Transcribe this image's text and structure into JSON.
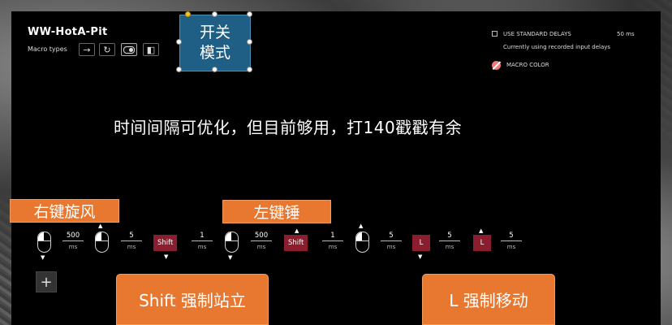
{
  "macro": {
    "name": "WW-HotA-Pit",
    "types_label": "Macro types"
  },
  "macro_type_buttons": [
    {
      "icon": "arrow-right-icon",
      "glyph": "→",
      "active": false
    },
    {
      "icon": "repeat-icon",
      "glyph": "↻",
      "active": false
    },
    {
      "icon": "toggle-icon",
      "glyph": "",
      "active": true
    },
    {
      "icon": "hold-icon",
      "glyph": "◧",
      "active": false
    }
  ],
  "sticky_note": {
    "line1": "开关",
    "line2": "模式"
  },
  "options": {
    "use_standard_delays_label": "USE STANDARD DELAYS",
    "delay_value": "50 ms",
    "recorded_info": "Currently using recorded input delays",
    "macro_color_label": "MACRO COLOR"
  },
  "caption": "时间间隔可优化，但目前够用，打140戳戳有余",
  "annotations": {
    "right_key_whirlwind": "右键旋风",
    "left_key_hammer": "左键锤",
    "shift_force_stand": "Shift 强制站立",
    "l_force_move": "L 强制移动"
  },
  "sequence": [
    {
      "type": "mouse",
      "direction": "down"
    },
    {
      "type": "delay",
      "value": "500",
      "unit": "ms"
    },
    {
      "type": "mouse",
      "direction": "up"
    },
    {
      "type": "delay",
      "value": "5",
      "unit": "ms"
    },
    {
      "type": "key",
      "label": "Shift",
      "direction": "down"
    },
    {
      "type": "delay",
      "value": "1",
      "unit": "ms"
    },
    {
      "type": "mouse",
      "direction": "down"
    },
    {
      "type": "delay",
      "value": "500",
      "unit": "ms"
    },
    {
      "type": "key",
      "label": "Shift",
      "direction": "up"
    },
    {
      "type": "delay",
      "value": "1",
      "unit": "ms"
    },
    {
      "type": "mouse",
      "direction": "up"
    },
    {
      "type": "delay",
      "value": "5",
      "unit": "ms"
    },
    {
      "type": "key",
      "label": "L",
      "direction": "down"
    },
    {
      "type": "delay",
      "value": "5",
      "unit": "ms"
    },
    {
      "type": "key",
      "label": "L",
      "direction": "up"
    },
    {
      "type": "delay",
      "value": "5",
      "unit": "ms"
    }
  ],
  "add_button": "+",
  "colors": {
    "note": "#1f5f86",
    "annotation": "#e8782f",
    "key": "#8b1e2e",
    "panel": "#000000"
  }
}
